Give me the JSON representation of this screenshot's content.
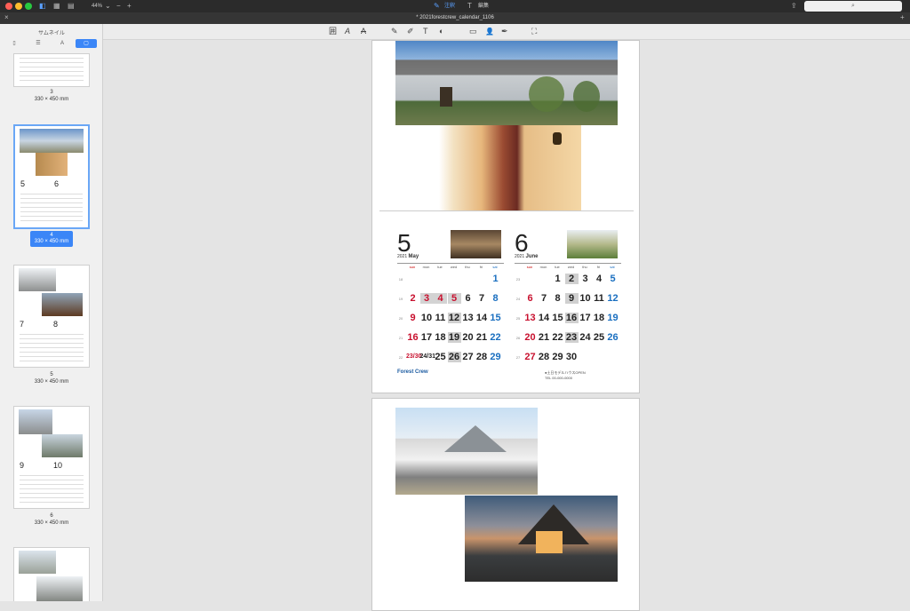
{
  "window": {
    "zoom": "44%",
    "tab_title": "* 2021forestcrew_calendar_1106",
    "mode_annotate": "注釈",
    "mode_edit": "編集",
    "search_placeholder": "",
    "search_icon": "⌕"
  },
  "sidebar": {
    "title": "サムネイル",
    "thumbs": [
      {
        "page": "3",
        "size": "330 × 450 mm"
      },
      {
        "page": "4",
        "size": "330 × 450 mm"
      },
      {
        "page": "5",
        "size": "330 × 450 mm"
      },
      {
        "page": "6",
        "size": "330 × 450 mm"
      }
    ],
    "thumb_months": [
      {
        "a": "5",
        "b": "6"
      },
      {
        "a": "7",
        "b": "8"
      },
      {
        "a": "9",
        "b": "10"
      }
    ]
  },
  "toolbar": {
    "icons": [
      "text-box-icon",
      "text-icon",
      "strikethrough-icon",
      "pencil-icon",
      "highlighter-icon",
      "text-tool-icon",
      "shapes-icon",
      "note-icon",
      "signature-icon",
      "pen-icon",
      "crop-icon"
    ],
    "glyphs": [
      "囲",
      "A",
      "A",
      "✎",
      "✐",
      "T",
      "◐",
      "▭",
      "👤",
      "✒",
      "⛶"
    ]
  },
  "calendar": {
    "weekdays": [
      "sun",
      "mon",
      "tue",
      "wed",
      "thu",
      "fri",
      "sat"
    ],
    "may": {
      "num": "5",
      "year": "2021",
      "name": "May",
      "weeks": [
        [
          "",
          "",
          "",
          "",
          "",
          "",
          "1"
        ],
        [
          "2",
          "3",
          "4",
          "5",
          "6",
          "7",
          "8"
        ],
        [
          "9",
          "10",
          "11",
          "12",
          "13",
          "14",
          "15"
        ],
        [
          "16",
          "17",
          "18",
          "19",
          "20",
          "21",
          "22"
        ],
        [
          "23/30",
          "24/31",
          "25",
          "26",
          "27",
          "28",
          "29"
        ]
      ],
      "wknums": [
        "18",
        "19",
        "20",
        "21",
        "22"
      ]
    },
    "june": {
      "num": "6",
      "year": "2021",
      "name": "June",
      "weeks": [
        [
          "",
          "",
          "1",
          "2",
          "3",
          "4",
          "5"
        ],
        [
          "6",
          "7",
          "8",
          "9",
          "10",
          "11",
          "12"
        ],
        [
          "13",
          "14",
          "15",
          "16",
          "17",
          "18",
          "19"
        ],
        [
          "20",
          "21",
          "22",
          "23",
          "24",
          "25",
          "26"
        ],
        [
          "27",
          "28",
          "29",
          "30",
          "",
          "",
          ""
        ]
      ],
      "wknums": [
        "23",
        "24",
        "25",
        "26",
        "27"
      ]
    },
    "brand": "Forest Crew",
    "footer_right": "●土日モデルハウスOPEN",
    "footer_tel": "TEL 00-000-0000"
  }
}
